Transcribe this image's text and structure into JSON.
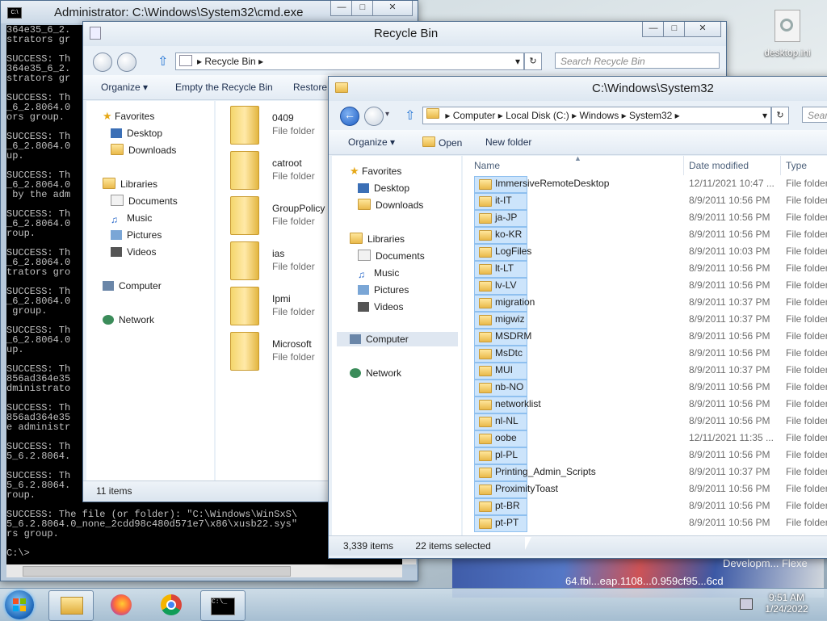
{
  "cmd": {
    "title": "Administrator: C:\\Windows\\System32\\cmd.exe",
    "lines": [
      "364e35_6_2.",
      "strators gr",
      "",
      "SUCCESS: Th",
      "364e35_6_2.",
      "strators gr",
      "",
      "SUCCESS: Th",
      "_6_2.8064.0",
      "ors group.",
      "",
      "SUCCESS: Th",
      "_6_2.8064.0",
      "up.",
      "",
      "SUCCESS: Th",
      "_6_2.8064.0",
      " by the adm",
      "",
      "SUCCESS: Th",
      "_6_2.8064.0",
      "roup.",
      "",
      "SUCCESS: Th",
      "_6_2.8064.0",
      "trators gro",
      "",
      "SUCCESS: Th",
      "_6_2.8064.0",
      " group.",
      "",
      "SUCCESS: Th",
      "_6_2.8064.0",
      "up.",
      "",
      "SUCCESS: Th",
      "856ad364e35",
      "dministrato",
      "",
      "SUCCESS: Th",
      "856ad364e35",
      "e administr",
      "",
      "SUCCESS: Th",
      "5_6.2.8064.",
      "",
      "SUCCESS: Th",
      "5_6.2.8064.",
      "roup.",
      "",
      "SUCCESS: The file (or folder): \"C:\\Windows\\WinSxS\\",
      "5_6.2.8064.0_none_2cdd98c480d571e7\\x86\\xusb22.sys\"",
      "rs group.",
      "",
      "C:\\>"
    ]
  },
  "recycle": {
    "title": "Recycle Bin",
    "address": "Recycle Bin",
    "search_placeholder": "Search Recycle Bin",
    "toolbar": {
      "organize": "Organize",
      "empty": "Empty the Recycle Bin",
      "restore": "Restore"
    },
    "nav": {
      "favorites": "Favorites",
      "desktop": "Desktop",
      "downloads": "Downloads",
      "libraries": "Libraries",
      "documents": "Documents",
      "music": "Music",
      "pictures": "Pictures",
      "videos": "Videos",
      "computer": "Computer",
      "network": "Network"
    },
    "items": [
      {
        "name": "0409",
        "type": "File folder"
      },
      {
        "name": "catroot",
        "type": "File folder"
      },
      {
        "name": "GroupPolicy",
        "type": "File folder"
      },
      {
        "name": "ias",
        "type": "File folder"
      },
      {
        "name": "Ipmi",
        "type": "File folder"
      },
      {
        "name": "Microsoft",
        "type": "File folder"
      }
    ],
    "status": "11 items"
  },
  "system32": {
    "title": "C:\\Windows\\System32",
    "breadcrumb": [
      "Computer",
      "Local Disk (C:)",
      "Windows",
      "System32"
    ],
    "search_placeholder": "Sear",
    "toolbar": {
      "organize": "Organize",
      "open": "Open",
      "new_folder": "New folder"
    },
    "nav": {
      "favorites": "Favorites",
      "desktop": "Desktop",
      "downloads": "Downloads",
      "libraries": "Libraries",
      "documents": "Documents",
      "music": "Music",
      "pictures": "Pictures",
      "videos": "Videos",
      "computer": "Computer",
      "network": "Network"
    },
    "columns": {
      "name": "Name",
      "date": "Date modified",
      "type": "Type"
    },
    "rows": [
      {
        "name": "ImmersiveRemoteDesktop",
        "date": "12/11/2021 10:47 ...",
        "type": "File folder"
      },
      {
        "name": "it-IT",
        "date": "8/9/2011 10:56 PM",
        "type": "File folder"
      },
      {
        "name": "ja-JP",
        "date": "8/9/2011 10:56 PM",
        "type": "File folder"
      },
      {
        "name": "ko-KR",
        "date": "8/9/2011 10:56 PM",
        "type": "File folder"
      },
      {
        "name": "LogFiles",
        "date": "8/9/2011 10:03 PM",
        "type": "File folder"
      },
      {
        "name": "lt-LT",
        "date": "8/9/2011 10:56 PM",
        "type": "File folder"
      },
      {
        "name": "lv-LV",
        "date": "8/9/2011 10:56 PM",
        "type": "File folder"
      },
      {
        "name": "migration",
        "date": "8/9/2011 10:37 PM",
        "type": "File folder"
      },
      {
        "name": "migwiz",
        "date": "8/9/2011 10:37 PM",
        "type": "File folder"
      },
      {
        "name": "MSDRM",
        "date": "8/9/2011 10:56 PM",
        "type": "File folder"
      },
      {
        "name": "MsDtc",
        "date": "8/9/2011 10:56 PM",
        "type": "File folder"
      },
      {
        "name": "MUI",
        "date": "8/9/2011 10:37 PM",
        "type": "File folder"
      },
      {
        "name": "nb-NO",
        "date": "8/9/2011 10:56 PM",
        "type": "File folder"
      },
      {
        "name": "networklist",
        "date": "8/9/2011 10:56 PM",
        "type": "File folder"
      },
      {
        "name": "nl-NL",
        "date": "8/9/2011 10:56 PM",
        "type": "File folder"
      },
      {
        "name": "oobe",
        "date": "12/11/2021 11:35 ...",
        "type": "File folder"
      },
      {
        "name": "pl-PL",
        "date": "8/9/2011 10:56 PM",
        "type": "File folder"
      },
      {
        "name": "Printing_Admin_Scripts",
        "date": "8/9/2011 10:37 PM",
        "type": "File folder"
      },
      {
        "name": "ProximityToast",
        "date": "8/9/2011 10:56 PM",
        "type": "File folder"
      },
      {
        "name": "pt-BR",
        "date": "8/9/2011 10:56 PM",
        "type": "File folder"
      },
      {
        "name": "pt-PT",
        "date": "8/9/2011 10:56 PM",
        "type": "File folder"
      }
    ],
    "status_items": "3,339 items",
    "status_selected": "22 items selected"
  },
  "desktop": {
    "icon_label": "desktop.ini",
    "wallpaper_text": "64.fbl...eap.1108...0.959cf95...6cd",
    "wallpaper_text2": "Developm... Flexe"
  },
  "clock": {
    "time": "9:51 AM",
    "date": "1/24/2022"
  }
}
